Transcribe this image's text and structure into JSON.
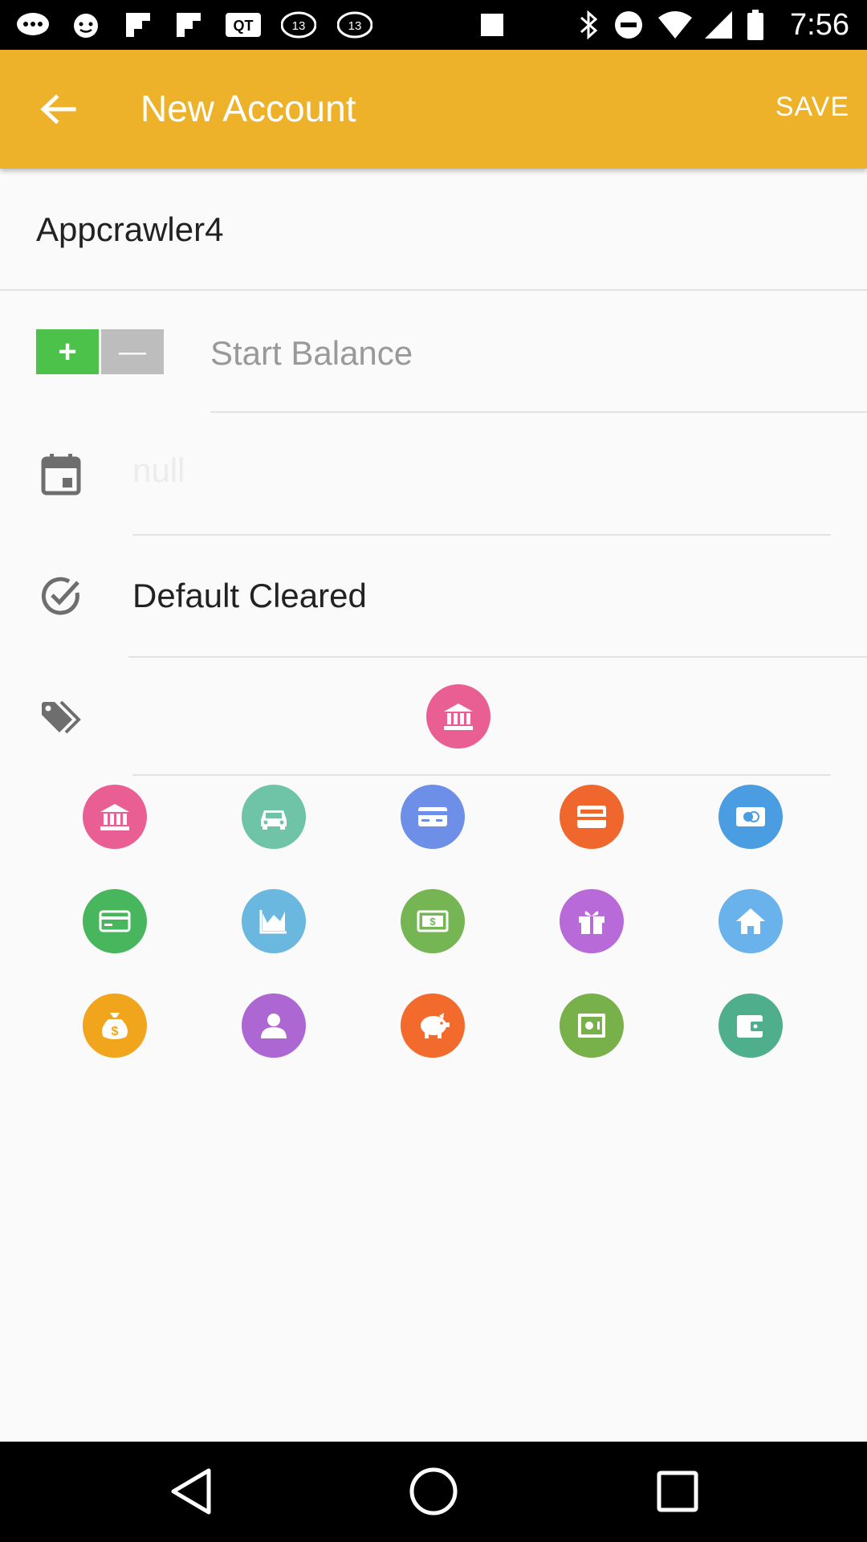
{
  "status_bar": {
    "time": "7:56",
    "notification_icons": [
      "messages-icon",
      "game-controller-icon",
      "flipboard-icon",
      "flipboard-icon",
      "qt-icon",
      "abc13-icon",
      "abc13-icon",
      "stop-icon"
    ],
    "system_icons": [
      "bluetooth-icon",
      "do-not-disturb-icon",
      "wifi-icon",
      "cell-signal-icon",
      "battery-icon"
    ]
  },
  "app_bar": {
    "title": "New Account",
    "save_label": "SAVE",
    "background_color": "#eeb22a"
  },
  "form": {
    "account_name": "Appcrawler4",
    "balance_placeholder": "Start Balance",
    "plus_label": "+",
    "minus_label": "—",
    "date_value": "null",
    "cleared_value": "Default Cleared"
  },
  "selected_account_icon": {
    "name": "bank-icon",
    "color": "#e95f93"
  },
  "account_icons": [
    {
      "name": "bank-icon",
      "color": "#e95f93"
    },
    {
      "name": "car-icon",
      "color": "#6fc3a6"
    },
    {
      "name": "credit-card-icon",
      "color": "#6e8fe8"
    },
    {
      "name": "debit-card-icon",
      "color": "#f0672e"
    },
    {
      "name": "id-card-icon",
      "color": "#4a9de0"
    },
    {
      "name": "payment-card-icon",
      "color": "#47b65c"
    },
    {
      "name": "chart-icon",
      "color": "#6ab7e0"
    },
    {
      "name": "cash-icon",
      "color": "#76b553"
    },
    {
      "name": "gift-icon",
      "color": "#b96ad9"
    },
    {
      "name": "home-icon",
      "color": "#6ab2ec"
    },
    {
      "name": "money-bag-icon",
      "color": "#f1a51d"
    },
    {
      "name": "person-icon",
      "color": "#ad67d3"
    },
    {
      "name": "piggy-bank-icon",
      "color": "#f26b2c"
    },
    {
      "name": "safe-icon",
      "color": "#78b04a"
    },
    {
      "name": "wallet-icon",
      "color": "#4faf8c"
    }
  ],
  "nav_bar": {
    "buttons": [
      "back-icon",
      "home-icon",
      "recents-icon"
    ]
  }
}
